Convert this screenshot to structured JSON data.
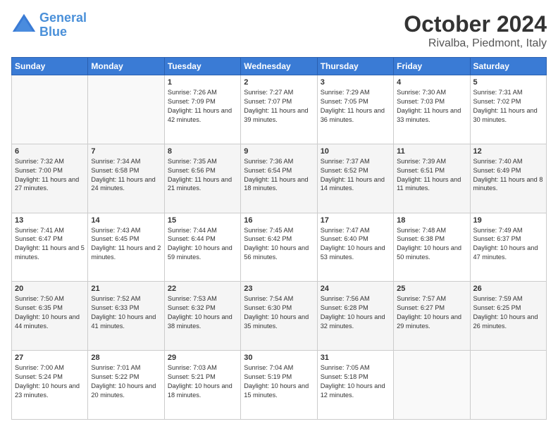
{
  "header": {
    "logo_line1": "General",
    "logo_line2": "Blue",
    "title": "October 2024",
    "subtitle": "Rivalba, Piedmont, Italy"
  },
  "days_of_week": [
    "Sunday",
    "Monday",
    "Tuesday",
    "Wednesday",
    "Thursday",
    "Friday",
    "Saturday"
  ],
  "weeks": [
    [
      {
        "day": "",
        "sunrise": "",
        "sunset": "",
        "daylight": ""
      },
      {
        "day": "",
        "sunrise": "",
        "sunset": "",
        "daylight": ""
      },
      {
        "day": "1",
        "sunrise": "Sunrise: 7:26 AM",
        "sunset": "Sunset: 7:09 PM",
        "daylight": "Daylight: 11 hours and 42 minutes."
      },
      {
        "day": "2",
        "sunrise": "Sunrise: 7:27 AM",
        "sunset": "Sunset: 7:07 PM",
        "daylight": "Daylight: 11 hours and 39 minutes."
      },
      {
        "day": "3",
        "sunrise": "Sunrise: 7:29 AM",
        "sunset": "Sunset: 7:05 PM",
        "daylight": "Daylight: 11 hours and 36 minutes."
      },
      {
        "day": "4",
        "sunrise": "Sunrise: 7:30 AM",
        "sunset": "Sunset: 7:03 PM",
        "daylight": "Daylight: 11 hours and 33 minutes."
      },
      {
        "day": "5",
        "sunrise": "Sunrise: 7:31 AM",
        "sunset": "Sunset: 7:02 PM",
        "daylight": "Daylight: 11 hours and 30 minutes."
      }
    ],
    [
      {
        "day": "6",
        "sunrise": "Sunrise: 7:32 AM",
        "sunset": "Sunset: 7:00 PM",
        "daylight": "Daylight: 11 hours and 27 minutes."
      },
      {
        "day": "7",
        "sunrise": "Sunrise: 7:34 AM",
        "sunset": "Sunset: 6:58 PM",
        "daylight": "Daylight: 11 hours and 24 minutes."
      },
      {
        "day": "8",
        "sunrise": "Sunrise: 7:35 AM",
        "sunset": "Sunset: 6:56 PM",
        "daylight": "Daylight: 11 hours and 21 minutes."
      },
      {
        "day": "9",
        "sunrise": "Sunrise: 7:36 AM",
        "sunset": "Sunset: 6:54 PM",
        "daylight": "Daylight: 11 hours and 18 minutes."
      },
      {
        "day": "10",
        "sunrise": "Sunrise: 7:37 AM",
        "sunset": "Sunset: 6:52 PM",
        "daylight": "Daylight: 11 hours and 14 minutes."
      },
      {
        "day": "11",
        "sunrise": "Sunrise: 7:39 AM",
        "sunset": "Sunset: 6:51 PM",
        "daylight": "Daylight: 11 hours and 11 minutes."
      },
      {
        "day": "12",
        "sunrise": "Sunrise: 7:40 AM",
        "sunset": "Sunset: 6:49 PM",
        "daylight": "Daylight: 11 hours and 8 minutes."
      }
    ],
    [
      {
        "day": "13",
        "sunrise": "Sunrise: 7:41 AM",
        "sunset": "Sunset: 6:47 PM",
        "daylight": "Daylight: 11 hours and 5 minutes."
      },
      {
        "day": "14",
        "sunrise": "Sunrise: 7:43 AM",
        "sunset": "Sunset: 6:45 PM",
        "daylight": "Daylight: 11 hours and 2 minutes."
      },
      {
        "day": "15",
        "sunrise": "Sunrise: 7:44 AM",
        "sunset": "Sunset: 6:44 PM",
        "daylight": "Daylight: 10 hours and 59 minutes."
      },
      {
        "day": "16",
        "sunrise": "Sunrise: 7:45 AM",
        "sunset": "Sunset: 6:42 PM",
        "daylight": "Daylight: 10 hours and 56 minutes."
      },
      {
        "day": "17",
        "sunrise": "Sunrise: 7:47 AM",
        "sunset": "Sunset: 6:40 PM",
        "daylight": "Daylight: 10 hours and 53 minutes."
      },
      {
        "day": "18",
        "sunrise": "Sunrise: 7:48 AM",
        "sunset": "Sunset: 6:38 PM",
        "daylight": "Daylight: 10 hours and 50 minutes."
      },
      {
        "day": "19",
        "sunrise": "Sunrise: 7:49 AM",
        "sunset": "Sunset: 6:37 PM",
        "daylight": "Daylight: 10 hours and 47 minutes."
      }
    ],
    [
      {
        "day": "20",
        "sunrise": "Sunrise: 7:50 AM",
        "sunset": "Sunset: 6:35 PM",
        "daylight": "Daylight: 10 hours and 44 minutes."
      },
      {
        "day": "21",
        "sunrise": "Sunrise: 7:52 AM",
        "sunset": "Sunset: 6:33 PM",
        "daylight": "Daylight: 10 hours and 41 minutes."
      },
      {
        "day": "22",
        "sunrise": "Sunrise: 7:53 AM",
        "sunset": "Sunset: 6:32 PM",
        "daylight": "Daylight: 10 hours and 38 minutes."
      },
      {
        "day": "23",
        "sunrise": "Sunrise: 7:54 AM",
        "sunset": "Sunset: 6:30 PM",
        "daylight": "Daylight: 10 hours and 35 minutes."
      },
      {
        "day": "24",
        "sunrise": "Sunrise: 7:56 AM",
        "sunset": "Sunset: 6:28 PM",
        "daylight": "Daylight: 10 hours and 32 minutes."
      },
      {
        "day": "25",
        "sunrise": "Sunrise: 7:57 AM",
        "sunset": "Sunset: 6:27 PM",
        "daylight": "Daylight: 10 hours and 29 minutes."
      },
      {
        "day": "26",
        "sunrise": "Sunrise: 7:59 AM",
        "sunset": "Sunset: 6:25 PM",
        "daylight": "Daylight: 10 hours and 26 minutes."
      }
    ],
    [
      {
        "day": "27",
        "sunrise": "Sunrise: 7:00 AM",
        "sunset": "Sunset: 5:24 PM",
        "daylight": "Daylight: 10 hours and 23 minutes."
      },
      {
        "day": "28",
        "sunrise": "Sunrise: 7:01 AM",
        "sunset": "Sunset: 5:22 PM",
        "daylight": "Daylight: 10 hours and 20 minutes."
      },
      {
        "day": "29",
        "sunrise": "Sunrise: 7:03 AM",
        "sunset": "Sunset: 5:21 PM",
        "daylight": "Daylight: 10 hours and 18 minutes."
      },
      {
        "day": "30",
        "sunrise": "Sunrise: 7:04 AM",
        "sunset": "Sunset: 5:19 PM",
        "daylight": "Daylight: 10 hours and 15 minutes."
      },
      {
        "day": "31",
        "sunrise": "Sunrise: 7:05 AM",
        "sunset": "Sunset: 5:18 PM",
        "daylight": "Daylight: 10 hours and 12 minutes."
      },
      {
        "day": "",
        "sunrise": "",
        "sunset": "",
        "daylight": ""
      },
      {
        "day": "",
        "sunrise": "",
        "sunset": "",
        "daylight": ""
      }
    ]
  ]
}
